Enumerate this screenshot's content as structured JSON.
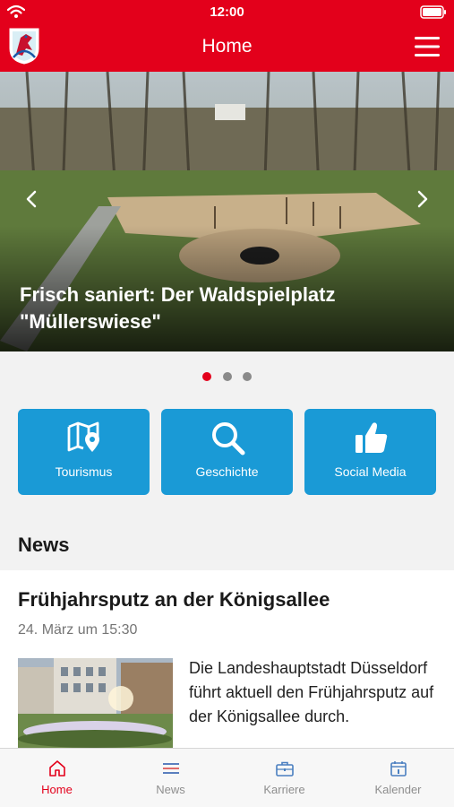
{
  "status_bar": {
    "time": "12:00"
  },
  "app_bar": {
    "title": "Home"
  },
  "carousel": {
    "caption": "Frisch saniert: Der Waldspielplatz \"Müllerswiese\"",
    "slide_count": 3,
    "active_index": 0
  },
  "tiles": [
    {
      "label": "Tourismus",
      "icon": "map-pin-icon"
    },
    {
      "label": "Geschichte",
      "icon": "search-icon"
    },
    {
      "label": "Social Media",
      "icon": "thumbs-up-icon"
    }
  ],
  "news": {
    "heading": "News",
    "article": {
      "title": "Frühjahrsputz an der Königsallee",
      "date": "24. März um 15:30",
      "teaser": "Die Landeshauptstadt Düsseldorf führt aktuell den Frühjahrsputz auf der Königsallee durch."
    }
  },
  "tabbar": {
    "items": [
      {
        "label": "Home",
        "icon": "home-icon",
        "active": true
      },
      {
        "label": "News",
        "icon": "news-list-icon",
        "active": false
      },
      {
        "label": "Karriere",
        "icon": "briefcase-icon",
        "active": false
      },
      {
        "label": "Kalender",
        "icon": "calendar-icon",
        "active": false
      }
    ]
  },
  "colors": {
    "brand_red": "#e3001b",
    "tile_blue": "#1a9ad6"
  }
}
